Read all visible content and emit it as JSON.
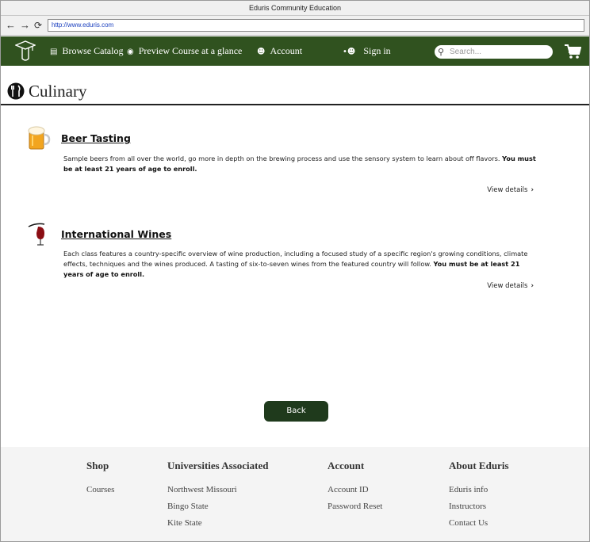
{
  "browser": {
    "title": "Eduris Community Education",
    "url": "http://www.eduris.com"
  },
  "nav": {
    "items": [
      {
        "label": "Browse Catalog",
        "icon": "catalog-icon"
      },
      {
        "label": "Preview Course at a glance",
        "icon": "eye-icon"
      },
      {
        "label": "Account",
        "icon": "account-icon"
      },
      {
        "label": "Sign in",
        "icon": "sign-in-icon"
      }
    ],
    "search_placeholder": "Search...",
    "brand_color": "#30521f"
  },
  "page": {
    "title": "Culinary"
  },
  "courses": [
    {
      "title": "Beer Tasting",
      "icon": "beer-mug-icon",
      "description": "Sample beers from all over the world, go more in depth on the brewing process and use the sensory system to learn about off flavors.",
      "requirement": "You must be at least 21 years of age to enroll.",
      "details_label": "View details"
    },
    {
      "title": "International Wines",
      "icon": "wine-glass-icon",
      "description": "Each class features a country-specific overview of wine production, including a focused study of a specific region's growing conditions, climate effects, techniques and the wines produced. A tasting of six-to-seven wines from the featured country will follow.",
      "requirement": "You must be at least 21 years of age to enroll.",
      "details_label": "View details"
    }
  ],
  "back_label": "Back",
  "footer": {
    "columns": [
      {
        "heading": "Shop",
        "links": [
          "Courses"
        ]
      },
      {
        "heading": "Universities Associated",
        "links": [
          "Northwest Missouri",
          "Bingo State",
          "Kite State"
        ]
      },
      {
        "heading": "Account",
        "links": [
          "Account ID",
          "Password Reset"
        ]
      },
      {
        "heading": "About Eduris",
        "links": [
          "Eduris info",
          "Instructors",
          "Contact Us"
        ]
      }
    ]
  }
}
